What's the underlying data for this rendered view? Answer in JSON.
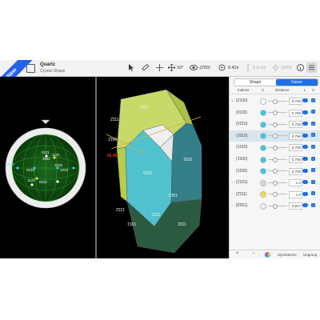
{
  "ribbon": "New",
  "header": {
    "title": "Quartz",
    "subtitle": "Crystal Shape"
  },
  "toolbar": {
    "rotation": "10°",
    "view_direction": "-(2̄30)",
    "zoom": "0.42x",
    "length": "6.0 cm",
    "percent": "100%"
  },
  "panel": {
    "tabs": [
      "Shape",
      "Faces"
    ],
    "active_tab": "Faces",
    "columns": [
      "Indices",
      "C",
      "Distance",
      "L",
      "V"
    ],
    "rows": [
      {
        "disc": "∨",
        "index": "{1̄100}",
        "color": "#ffffff",
        "distance": "0.756"
      },
      {
        "disc": "",
        "index": "(011̄0)",
        "color": "#36c8e0",
        "distance": "0.756"
      },
      {
        "disc": "",
        "index": "(01̄10)",
        "color": "#36c8e0",
        "distance": "0.756"
      },
      {
        "disc": "",
        "index": "(1̄010)",
        "color": "#36c8e0",
        "distance": "0.756",
        "selected": true
      },
      {
        "disc": "",
        "index": "(101̄0)",
        "color": "#36c8e0",
        "distance": "0.756"
      },
      {
        "disc": "",
        "index": "(1̄100)",
        "color": "#36c8e0",
        "distance": "0.756"
      },
      {
        "disc": "",
        "index": "(11̄00)",
        "color": "#36c8e0",
        "distance": "0.756"
      },
      {
        "disc": ">",
        "index": "{1̄101}",
        "color": "#d8d8d8",
        "distance": "1.0"
      },
      {
        "disc": ">",
        "index": "{2̄111}",
        "color": "#e8e04a",
        "distance": "1.0"
      },
      {
        "disc": ">",
        "index": "{5̄1̄61}",
        "color": "#f0f0f0",
        "distance": "0.847"
      }
    ],
    "footer": {
      "add": "+",
      "remove": "−",
      "symmetrize": "Symmetrize",
      "ungroup": "Ungroup"
    }
  },
  "stereo_labels": [
    "011̄1",
    "112̄1",
    "1̄5̄61",
    "1̄010",
    "01̄10",
    "112̄1̄",
    "011̄1̄",
    "1̄100",
    "101̄0"
  ],
  "crystal_labels": [
    "011̄1",
    "2̄111",
    "1̄100",
    "011̄0",
    "1̄010",
    "5̄1̄61",
    "1̄121",
    "1̄101",
    "1̄011",
    "2̄11̄1",
    "66.80°"
  ]
}
